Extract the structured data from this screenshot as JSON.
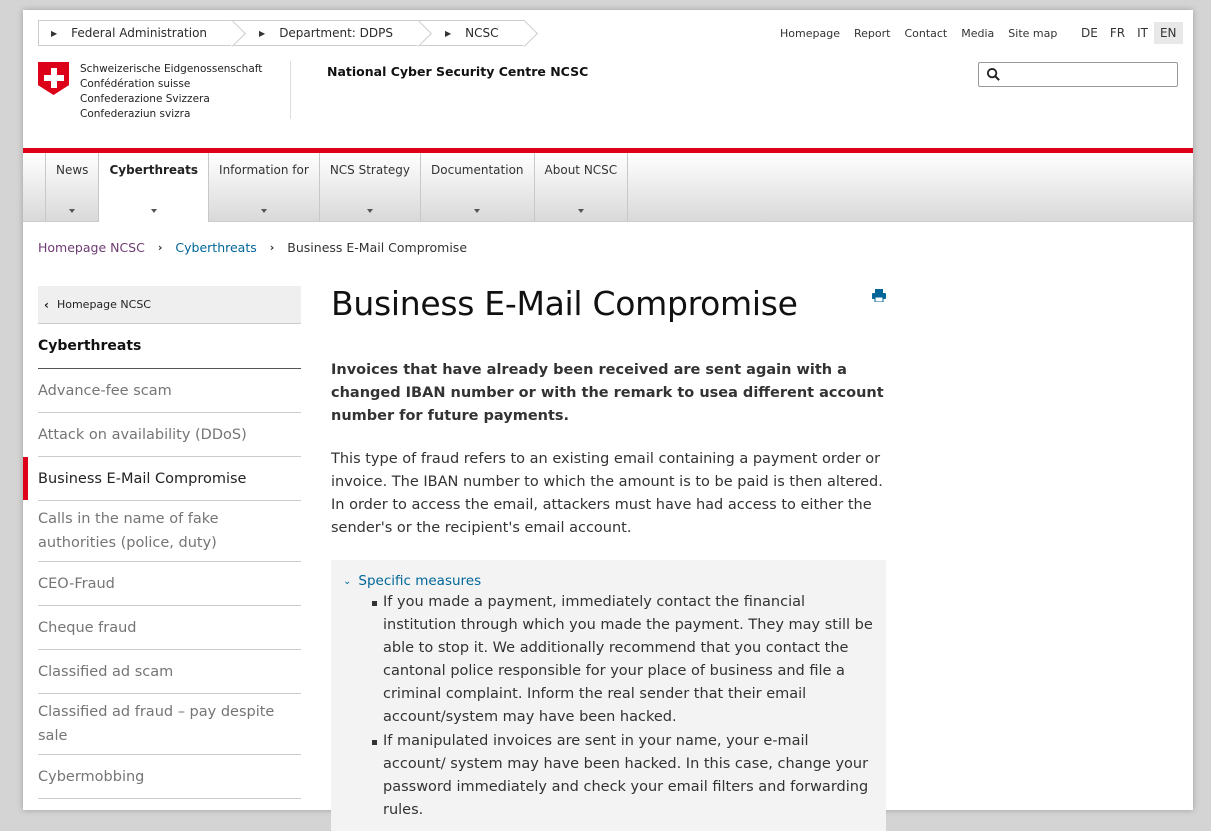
{
  "top_breadcrumb": [
    "Federal Administration",
    "Department: DDPS",
    "NCSC"
  ],
  "top_links": [
    "Homepage",
    "Report",
    "Contact",
    "Media",
    "Site map"
  ],
  "languages": [
    "DE",
    "FR",
    "IT",
    "EN"
  ],
  "active_language": "EN",
  "brand": {
    "lines": [
      "Schweizerische Eidgenossenschaft",
      "Confédération suisse",
      "Confederazione Svizzera",
      "Confederaziun svizra"
    ],
    "org_title": "National Cyber Security Centre NCSC"
  },
  "search": {
    "placeholder": ""
  },
  "nav": [
    "News",
    "Cyberthreats",
    "Information for",
    "NCS Strategy",
    "Documentation",
    "About NCSC"
  ],
  "nav_active": "Cyberthreats",
  "breadcrumb": {
    "home": "Homepage NCSC",
    "section": "Cyberthreats",
    "current": "Business E-Mail Compromise"
  },
  "sidebar": {
    "back": "Homepage NCSC",
    "heading": "Cyberthreats",
    "items": [
      "Advance-fee scam",
      "Attack on availability (DDoS)",
      "Business E-Mail Compromise",
      "Calls in the name of fake authorities (police, duty)",
      "CEO-Fraud",
      "Cheque fraud",
      "Classified ad scam",
      "Classified ad fraud – pay despite sale",
      "Cybermobbing"
    ],
    "active": "Business E-Mail Compromise"
  },
  "main": {
    "title": "Business E-Mail Compromise",
    "lead": "Invoices that have already been received are sent again with a changed IBAN number or with the remark to usea different account number for future payments.",
    "body": "This type of fraud refers to an existing email containing a payment order or invoice. The IBAN number to which the amount is to be paid is then altered. In order to access the email, attackers must have had access to either the sender's or the recipient's email account.",
    "accordion_title": "Specific measures",
    "accordion_items": [
      "If you made a payment, immediately contact the financial institution through which you made the payment. They may still be able to stop it. We additionally recommend that you contact the cantonal police responsible for your place of business and file a criminal complaint. Inform the real sender that their email account/system may have been hacked.",
      "If manipulated invoices are sent in your name, your e-mail account/ system may have been hacked. In this case, change your password immediately and check your email filters and forwarding rules."
    ]
  },
  "colors": {
    "swiss_red": "#dc0018",
    "link_blue": "#006699",
    "link_purple": "#6e3c74"
  }
}
